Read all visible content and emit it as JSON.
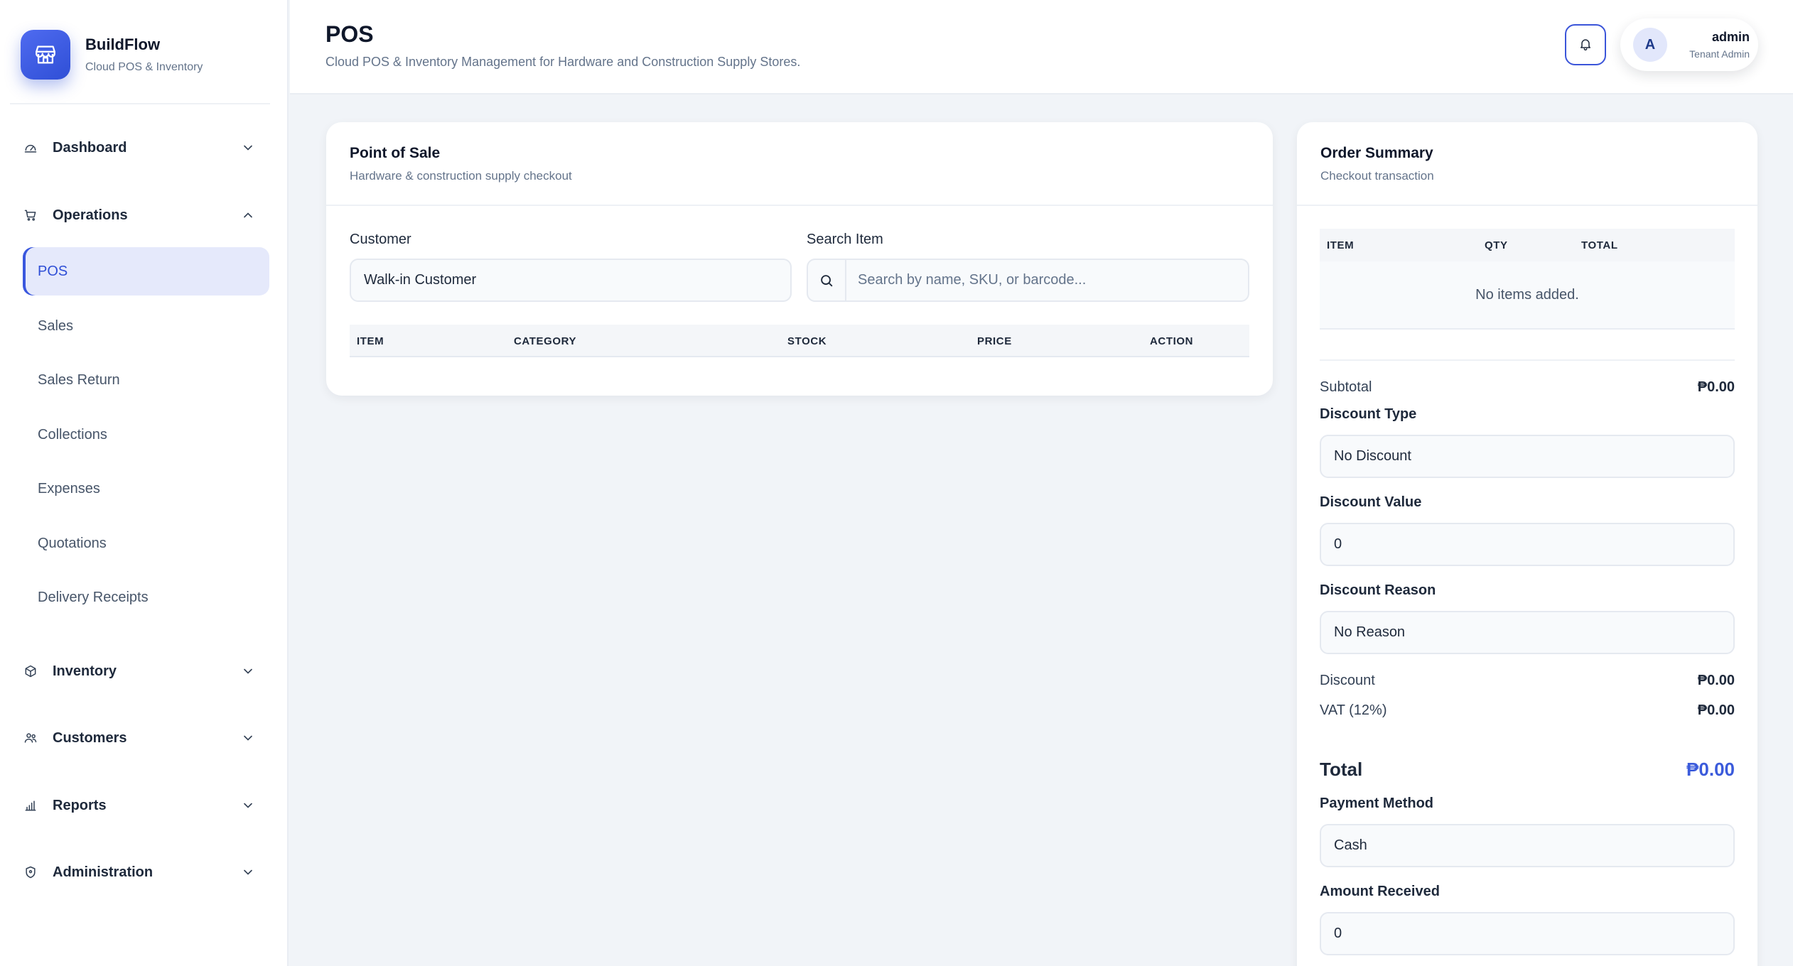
{
  "brand": {
    "name": "BuildFlow",
    "subtitle": "Cloud POS & Inventory"
  },
  "sidebar": {
    "groups": [
      {
        "label": "Dashboard",
        "icon": "gauge-icon",
        "expanded": false
      },
      {
        "label": "Operations",
        "icon": "cart-icon",
        "expanded": true
      },
      {
        "label": "Inventory",
        "icon": "box-icon",
        "expanded": false
      },
      {
        "label": "Customers",
        "icon": "users-icon",
        "expanded": false
      },
      {
        "label": "Reports",
        "icon": "bar-chart-icon",
        "expanded": false
      },
      {
        "label": "Administration",
        "icon": "shield-icon",
        "expanded": false
      }
    ],
    "operations_items": [
      {
        "label": "POS",
        "active": true
      },
      {
        "label": "Sales"
      },
      {
        "label": "Sales Return"
      },
      {
        "label": "Collections"
      },
      {
        "label": "Expenses"
      },
      {
        "label": "Quotations"
      },
      {
        "label": "Delivery Receipts"
      }
    ]
  },
  "header": {
    "title": "POS",
    "subtitle": "Cloud POS & Inventory Management for Hardware and Construction Supply Stores.",
    "user": {
      "initial": "A",
      "name": "admin",
      "role": "Tenant Admin"
    }
  },
  "pos": {
    "title": "Point of Sale",
    "subtitle": "Hardware & construction supply checkout",
    "customer_label": "Customer",
    "customer_value": "Walk-in Customer",
    "search_label": "Search Item",
    "search_placeholder": "Search by name, SKU, or barcode...",
    "columns": [
      "ITEM",
      "CATEGORY",
      "STOCK",
      "PRICE",
      "ACTION"
    ]
  },
  "order": {
    "title": "Order Summary",
    "subtitle": "Checkout transaction",
    "columns": [
      "ITEM",
      "QTY",
      "TOTAL"
    ],
    "empty_text": "No items added.",
    "subtotal_label": "Subtotal",
    "subtotal_value": "₱0.00",
    "discount_type_label": "Discount Type",
    "discount_type_value": "No Discount",
    "discount_value_label": "Discount Value",
    "discount_value_value": "0",
    "discount_reason_label": "Discount Reason",
    "discount_reason_value": "No Reason",
    "discount_label": "Discount",
    "discount_value": "₱0.00",
    "vat_label": "VAT (12%)",
    "vat_value": "₱0.00",
    "total_label": "Total",
    "total_value": "₱0.00",
    "payment_method_label": "Payment Method",
    "payment_method_value": "Cash",
    "amount_received_label": "Amount Received",
    "amount_received_value": "0"
  },
  "colors": {
    "accent": "#3b5bdb",
    "active_bg": "#e5e9fb",
    "page_bg": "#f1f4f8"
  }
}
